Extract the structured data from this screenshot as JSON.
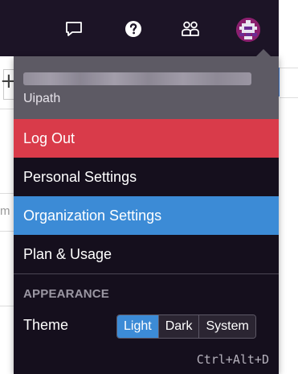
{
  "topbar": {
    "icons": [
      "chat-icon",
      "help-icon",
      "team-icon",
      "avatar"
    ]
  },
  "background": {
    "plus_text": "+",
    "input_fragment": "m"
  },
  "menu": {
    "account": {
      "email": "████████████████",
      "org_name": "Uipath"
    },
    "items": [
      {
        "label": "Log Out"
      },
      {
        "label": "Personal Settings"
      },
      {
        "label": "Organization Settings"
      },
      {
        "label": "Plan & Usage"
      }
    ],
    "appearance": {
      "section_label": "APPEARANCE",
      "theme_label": "Theme",
      "options": [
        "Light",
        "Dark",
        "System"
      ],
      "selected": "Light"
    },
    "shortcut": "Ctrl+Alt+D"
  },
  "colors": {
    "topbar": "#1c1426",
    "menu_bg": "#150f1d",
    "account_bg": "#5d5a64",
    "logout": "#d93b4a",
    "selected": "#3c8bd6"
  }
}
